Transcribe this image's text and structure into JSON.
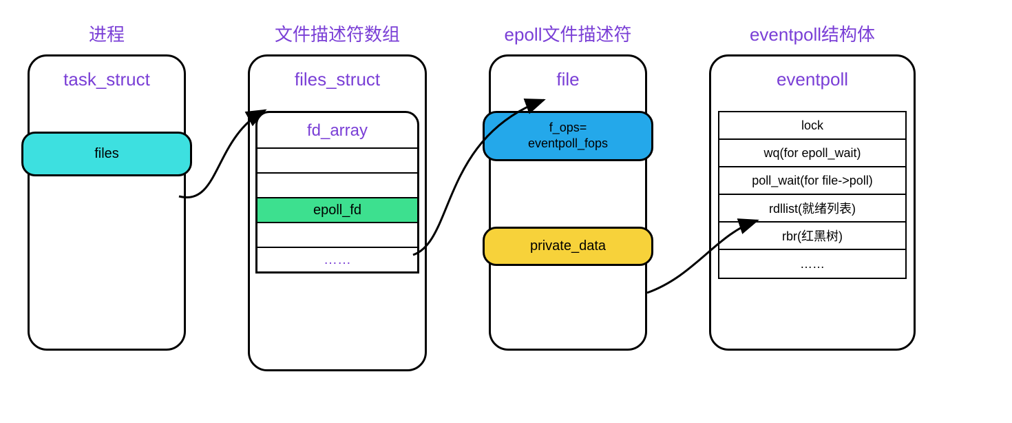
{
  "columns": {
    "col1": {
      "title": "进程",
      "struct_name": "task_struct",
      "field": "files"
    },
    "col2": {
      "title": "文件描述符数组",
      "struct_name": "files_struct",
      "inner_title": "fd_array",
      "rows": {
        "r1": "",
        "r2": "",
        "r3": "epoll_fd",
        "r4": "",
        "r5": "……"
      }
    },
    "col3": {
      "title": "epoll文件描述符",
      "struct_name": "file",
      "field1": "f_ops=\neventpoll_fops",
      "field2": "private_data"
    },
    "col4": {
      "title": "eventpoll结构体",
      "struct_name": "eventpoll",
      "rows": {
        "r1": "lock",
        "r2": "wq(for epoll_wait)",
        "r3": "poll_wait(for file->poll)",
        "r4": "rdllist(就绪列表)",
        "r5": "rbr(红黑树)",
        "r6": "……"
      }
    }
  }
}
